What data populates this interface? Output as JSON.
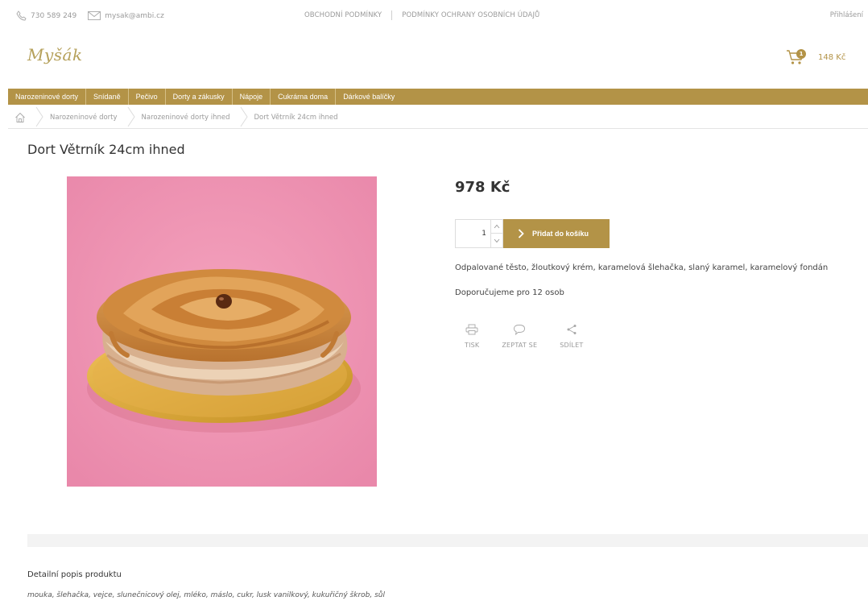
{
  "topbar": {
    "phone": "730 589 249",
    "email": "mysak@ambi.cz",
    "links": [
      "OBCHODNÍ PODMÍNKY",
      "PODMÍNKY OCHRANY OSOBNÍCH ÚDAJŮ"
    ],
    "login": "Přihlášení"
  },
  "logo": {
    "text": "Myšák"
  },
  "cart": {
    "count": "1",
    "total": "148 Kč"
  },
  "nav": {
    "items": [
      {
        "label": "Narozeninové dorty"
      },
      {
        "label": "Snídaně"
      },
      {
        "label": "Pečivo"
      },
      {
        "label": "Dorty a zákusky"
      },
      {
        "label": "Nápoje"
      },
      {
        "label": "Cukrárna doma"
      },
      {
        "label": "Dárkové balíčky"
      }
    ]
  },
  "breadcrumb": {
    "items": [
      "Narozeninové dorty",
      "Narozeninové dorty ihned",
      "Dort Větrník 24cm ihned"
    ]
  },
  "product": {
    "title": "Dort Větrník 24cm ihned",
    "price": "978 Kč",
    "quantity": "1",
    "add_to_cart": "Přidat do košíku",
    "description": "Odpalované těsto, žloutkový krém, karamelová šlehačka, slaný karamel, karamelový fondán",
    "recommendation": "Doporučujeme pro 12 osob",
    "actions": [
      {
        "label": "TISK",
        "icon": "printer-icon"
      },
      {
        "label": "ZEPTAT SE",
        "icon": "speech-bubble-icon"
      },
      {
        "label": "SDÍLET",
        "icon": "share-icon"
      }
    ]
  },
  "detail": {
    "title": "Detailní popis produktu",
    "ingredients": "mouka, šlehačka, vejce, slunečnicový olej, mléko, máslo, cukr, lusk vanilkový, kukuřičný škrob, sůl"
  },
  "colors": {
    "accent": "#b39347",
    "photo_background": "#ef93b1"
  }
}
